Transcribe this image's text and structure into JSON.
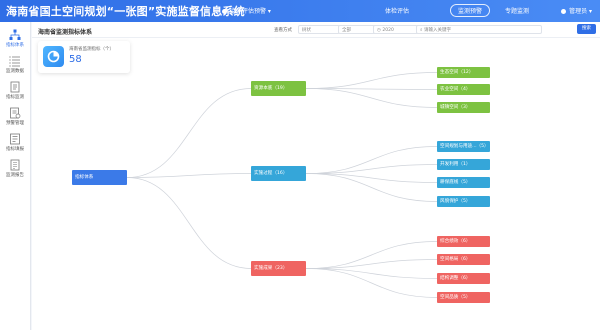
{
  "header": {
    "title": "海南省国土空间规划“一张图”实施监督信息系统",
    "system_select": "监测评估预警",
    "nav": [
      "体检评估",
      "监测预警",
      "专题监测"
    ],
    "active_nav": "监测预警",
    "user": "管理员"
  },
  "sidebar": {
    "items": [
      {
        "label": "指标体系",
        "icon": "org-tree-icon",
        "active": true
      },
      {
        "label": "监测数据",
        "icon": "list-icon",
        "active": false
      },
      {
        "label": "指标监测",
        "icon": "document-icon",
        "active": false
      },
      {
        "label": "预警管理",
        "icon": "warning-doc-icon",
        "active": false
      },
      {
        "label": "指标填报",
        "icon": "form-icon",
        "active": false
      },
      {
        "label": "监测报告",
        "icon": "report-icon",
        "active": false
      }
    ]
  },
  "toolbar": {
    "page_title": "海南省监测指标体系",
    "filter1_label": "查看方式",
    "filter1_value": "树状",
    "filter2_label": "",
    "filter2_value": "全部",
    "year_value": "2020",
    "search_placeholder": "请输入关键字",
    "search_button": "搜索"
  },
  "summary_card": {
    "label": "海南省监测指标（个）",
    "value": "58"
  },
  "tree": {
    "root": {
      "label": "指标体系",
      "color": "#3b7ae8"
    },
    "branches": [
      {
        "label": "资源本底（19）",
        "color": "#7dc241",
        "children": [
          "生态空间（12）",
          "农业空间（4）",
          "城镇空间（3）"
        ]
      },
      {
        "label": "实施过程（16）",
        "color": "#35a6d9",
        "children": [
          "空间规划与用途...（5）",
          "开发利用（1）",
          "耕保底线（5）",
          "风貌保护（5）"
        ]
      },
      {
        "label": "实施成果（23）",
        "color": "#ef6461",
        "children": [
          "综合绩效（6）",
          "空间格局（6）",
          "结构调整（6）",
          "空间品质（5）"
        ]
      }
    ]
  }
}
